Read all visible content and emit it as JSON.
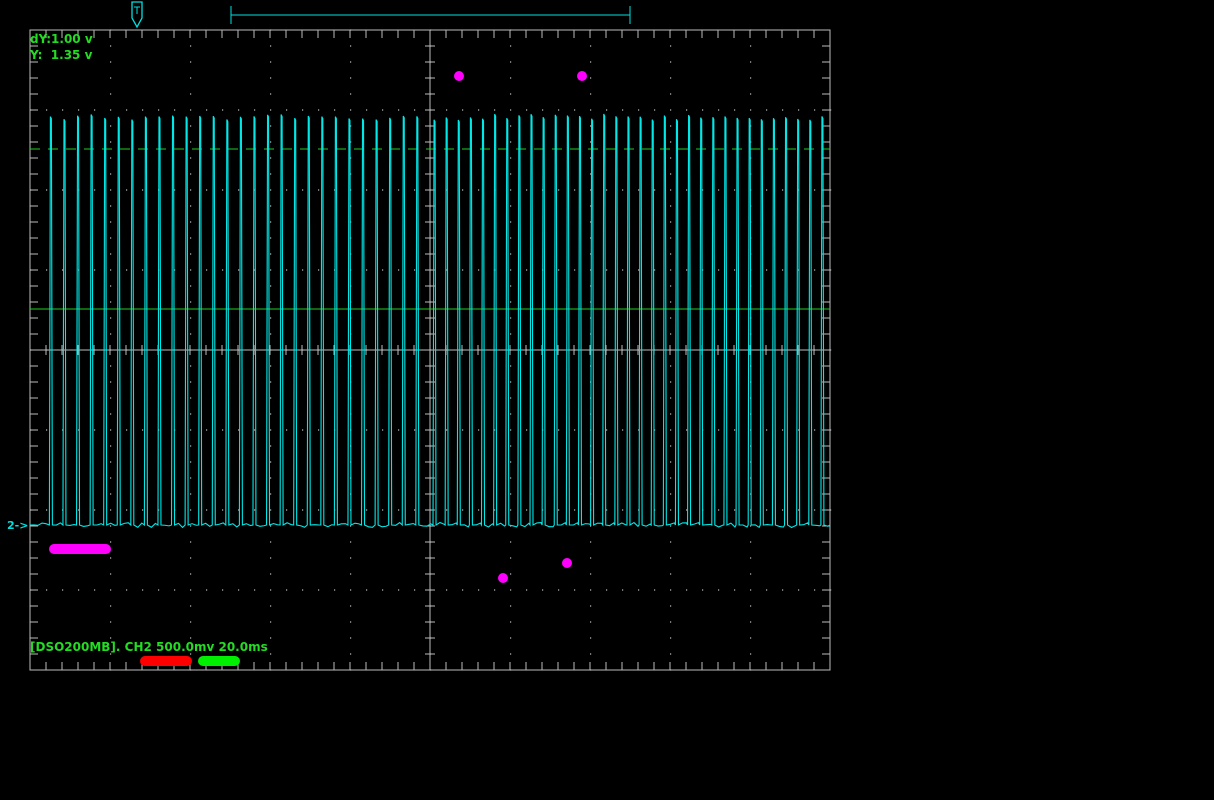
{
  "colors": {
    "background": "#000000",
    "grid": "#bbbbbb",
    "trace": "#00e8e8",
    "threshold": "#22cc22",
    "readout_text": "#22dd22",
    "cursor_dot": "#ff00ff",
    "indicator_magenta": "#ff00ff",
    "indicator_red": "#ff0000",
    "indicator_green": "#00ee00"
  },
  "readouts": {
    "dy": "dY:1.00 v",
    "y": "Y:  1.35 v",
    "status": "[DSO200MB]. CH2 500.0mv 20.0ms"
  },
  "channel_marker": "2->",
  "chart_data": {
    "type": "line",
    "title": "",
    "xlabel": "",
    "ylabel": "",
    "channel": "CH2",
    "volts_per_div": 0.5,
    "time_per_div_ms": 20.0,
    "divisions": {
      "x": 10,
      "y": 8
    },
    "threshold_div_above_ground": 5.4,
    "dashed_ref_div_above_ground": 9.4,
    "high_level_div_above_ground": 10.2,
    "pulse_groups": [
      {
        "start_div": 0.2,
        "end_div": 4.95,
        "count": 28
      },
      {
        "start_div": 5.0,
        "end_div": 10.0,
        "count": 33
      }
    ],
    "cursor_points": [
      {
        "x_div": 5.6,
        "level": "top"
      },
      {
        "x_div": 7.2,
        "level": "top"
      },
      {
        "x_div": 6.15,
        "level": "bottom-low"
      },
      {
        "x_div": 6.95,
        "level": "bottom-high"
      }
    ]
  }
}
